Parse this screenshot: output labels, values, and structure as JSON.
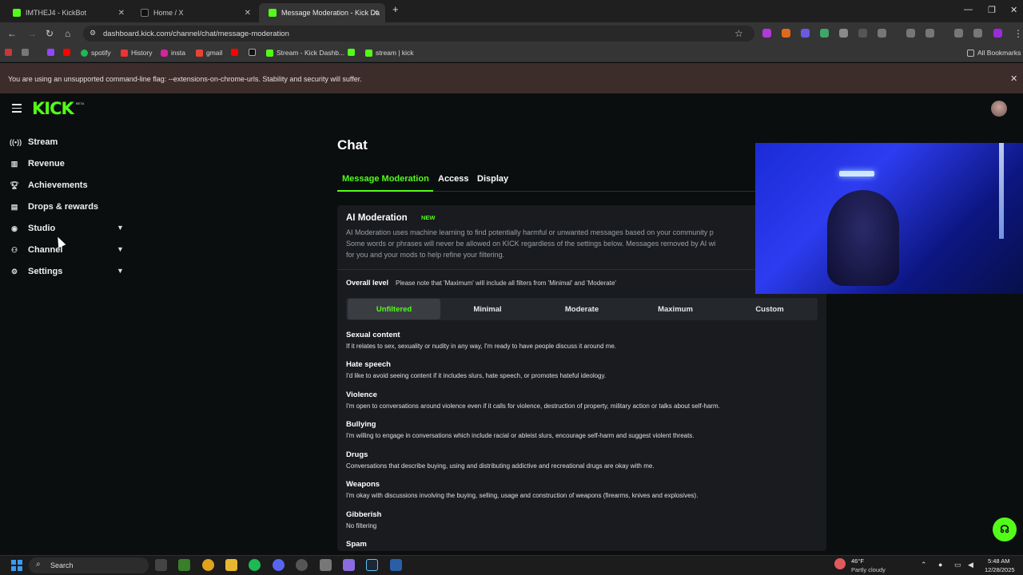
{
  "browser": {
    "tabs": [
      {
        "title": "IMTHEJ4 - KickBot",
        "active": false
      },
      {
        "title": "Home / X",
        "active": false
      },
      {
        "title": "Message Moderation - Kick Da",
        "active": true
      }
    ],
    "new_tab": "+",
    "url": "dashboard.kick.com/channel/chat/message-moderation",
    "bookmarks": [
      "spotify",
      "History",
      "insta",
      "gmail",
      "Stream - Kick Dashb...",
      "stream | kick"
    ],
    "all_bookmarks": "All Bookmarks",
    "infobar": "You are using an unsupported command-line flag: --extensions-on-chrome-urls. Stability and security will suffer."
  },
  "header": {
    "logo": "KICK",
    "logo_badge": "BETA"
  },
  "sidebar": {
    "items": [
      {
        "label": "Stream",
        "icon": "broadcast-icon"
      },
      {
        "label": "Revenue",
        "icon": "chart-icon"
      },
      {
        "label": "Achievements",
        "icon": "trophy-icon"
      },
      {
        "label": "Drops & rewards",
        "icon": "gift-icon"
      },
      {
        "label": "Studio",
        "icon": "studio-icon"
      },
      {
        "label": "Channel",
        "icon": "users-icon"
      },
      {
        "label": "Settings",
        "icon": "gear-icon"
      }
    ]
  },
  "main": {
    "title": "Chat",
    "tabs": [
      "Message Moderation",
      "Access",
      "Display"
    ],
    "ai": {
      "title": "AI Moderation",
      "badge": "NEW",
      "desc": [
        "AI Moderation uses machine learning to find potentially harmful or unwanted messages based on your community p",
        "Some words or phrases will never be allowed on KICK regardless of the settings below. Messages removed by AI wi",
        "for you and your mods to help refine your filtering."
      ]
    },
    "overall": {
      "label": "Overall level",
      "note": "Please note that 'Maximum' will include all filters from 'Minimal' and 'Moderate'",
      "levels": [
        "Unfiltered",
        "Minimal",
        "Moderate",
        "Maximum",
        "Custom"
      ],
      "selected": "Unfiltered"
    },
    "categories": [
      {
        "title": "Sexual content",
        "desc": "If it relates to sex, sexuality or nudity in any way, I'm ready to have people discuss it around me."
      },
      {
        "title": "Hate speech",
        "desc": "I'd like to avoid seeing content if it includes slurs, hate speech, or promotes hateful ideology."
      },
      {
        "title": "Violence",
        "desc": "I'm open to conversations around violence even if it calls for violence, destruction of property, military action or talks about self-harm."
      },
      {
        "title": "Bullying",
        "desc": "I'm willing to engage in conversations which include racial or ableist slurs, encourage self-harm and suggest violent threats."
      },
      {
        "title": "Drugs",
        "desc": "Conversations that describe buying, using and distributing addictive and recreational drugs are okay with me."
      },
      {
        "title": "Weapons",
        "desc": "I'm okay with discussions involving the buying, selling, usage and construction of weapons (firearms, knives and explosives)."
      },
      {
        "title": "Gibberish",
        "desc": "No filtering"
      },
      {
        "title": "Spam",
        "desc": ""
      }
    ]
  },
  "taskbar": {
    "search": "Search",
    "weather_temp": "46°F",
    "weather_desc": "Partly cloudy",
    "time": "5:48 AM",
    "date": "12/28/2025"
  },
  "colors": {
    "accent": "#53fc18",
    "background": "#0b0e0f",
    "card": "#191b1f"
  }
}
